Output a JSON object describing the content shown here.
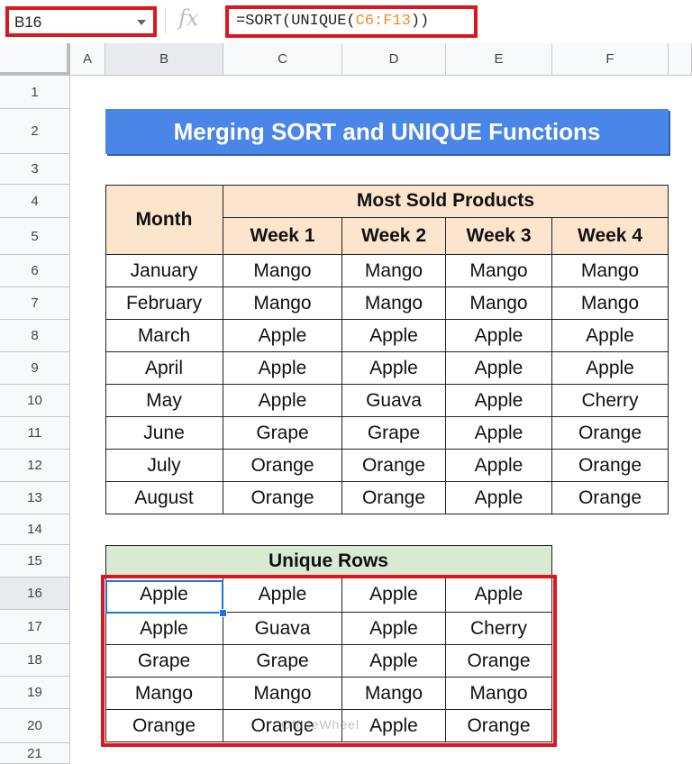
{
  "name_box": {
    "value": "B16"
  },
  "formula_bar": {
    "fx_label": "fx",
    "formula_prefix": "=SORT(UNIQUE(",
    "formula_ref": "C6:F13",
    "formula_suffix": "))"
  },
  "columns": [
    "A",
    "B",
    "C",
    "D",
    "E",
    "F"
  ],
  "rows": [
    "1",
    "2",
    "3",
    "4",
    "5",
    "6",
    "7",
    "8",
    "9",
    "10",
    "11",
    "12",
    "13",
    "14",
    "15",
    "16",
    "17",
    "18",
    "19",
    "20",
    "21"
  ],
  "title": "Merging SORT and UNIQUE Functions",
  "main_table": {
    "month_header": "Month",
    "group_header": "Most Sold Products",
    "week_headers": [
      "Week 1",
      "Week 2",
      "Week 3",
      "Week 4"
    ],
    "rows": [
      [
        "January",
        "Mango",
        "Mango",
        "Mango",
        "Mango"
      ],
      [
        "February",
        "Mango",
        "Mango",
        "Mango",
        "Mango"
      ],
      [
        "March",
        "Apple",
        "Apple",
        "Apple",
        "Apple"
      ],
      [
        "April",
        "Apple",
        "Apple",
        "Apple",
        "Apple"
      ],
      [
        "May",
        "Apple",
        "Guava",
        "Apple",
        "Cherry"
      ],
      [
        "June",
        "Grape",
        "Grape",
        "Apple",
        "Orange"
      ],
      [
        "July",
        "Orange",
        "Orange",
        "Apple",
        "Orange"
      ],
      [
        "August",
        "Orange",
        "Orange",
        "Apple",
        "Orange"
      ]
    ]
  },
  "unique_table": {
    "header": "Unique Rows",
    "rows": [
      [
        "Apple",
        "Apple",
        "Apple",
        "Apple"
      ],
      [
        "Apple",
        "Guava",
        "Apple",
        "Cherry"
      ],
      [
        "Grape",
        "Grape",
        "Apple",
        "Orange"
      ],
      [
        "Mango",
        "Mango",
        "Mango",
        "Mango"
      ],
      [
        "Orange",
        "Orange",
        "Apple",
        "Orange"
      ]
    ]
  },
  "watermark": "OfficeWheel",
  "colors": {
    "title_bg": "#4a86e8",
    "header_bg": "#fce5cd",
    "unique_header_bg": "#d9ead3",
    "highlight": "#e0141e",
    "selection": "#1a73e8"
  }
}
